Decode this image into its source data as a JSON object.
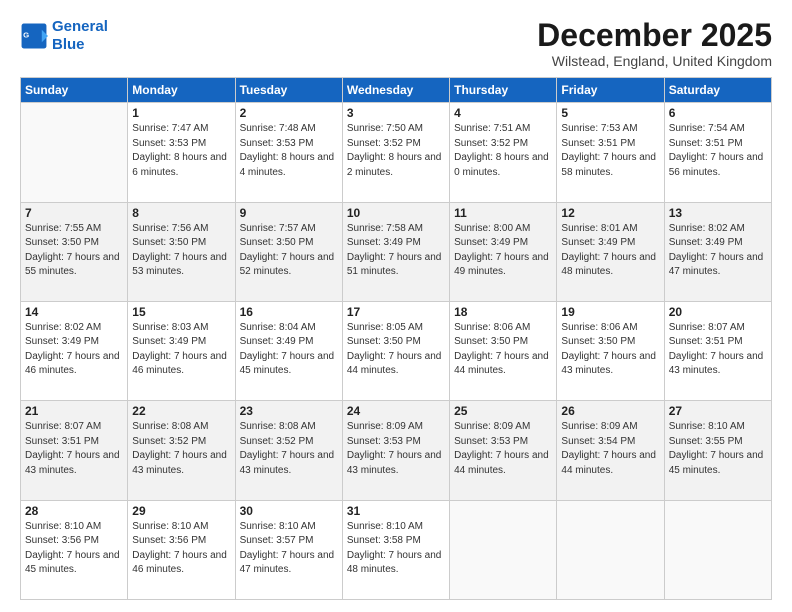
{
  "logo": {
    "line1": "General",
    "line2": "Blue"
  },
  "title": "December 2025",
  "location": "Wilstead, England, United Kingdom",
  "weekdays": [
    "Sunday",
    "Monday",
    "Tuesday",
    "Wednesday",
    "Thursday",
    "Friday",
    "Saturday"
  ],
  "weeks": [
    [
      {
        "day": "",
        "empty": true
      },
      {
        "day": "1",
        "sunrise": "Sunrise: 7:47 AM",
        "sunset": "Sunset: 3:53 PM",
        "daylight": "Daylight: 8 hours and 6 minutes."
      },
      {
        "day": "2",
        "sunrise": "Sunrise: 7:48 AM",
        "sunset": "Sunset: 3:53 PM",
        "daylight": "Daylight: 8 hours and 4 minutes."
      },
      {
        "day": "3",
        "sunrise": "Sunrise: 7:50 AM",
        "sunset": "Sunset: 3:52 PM",
        "daylight": "Daylight: 8 hours and 2 minutes."
      },
      {
        "day": "4",
        "sunrise": "Sunrise: 7:51 AM",
        "sunset": "Sunset: 3:52 PM",
        "daylight": "Daylight: 8 hours and 0 minutes."
      },
      {
        "day": "5",
        "sunrise": "Sunrise: 7:53 AM",
        "sunset": "Sunset: 3:51 PM",
        "daylight": "Daylight: 7 hours and 58 minutes."
      },
      {
        "day": "6",
        "sunrise": "Sunrise: 7:54 AM",
        "sunset": "Sunset: 3:51 PM",
        "daylight": "Daylight: 7 hours and 56 minutes."
      }
    ],
    [
      {
        "day": "7",
        "sunrise": "Sunrise: 7:55 AM",
        "sunset": "Sunset: 3:50 PM",
        "daylight": "Daylight: 7 hours and 55 minutes."
      },
      {
        "day": "8",
        "sunrise": "Sunrise: 7:56 AM",
        "sunset": "Sunset: 3:50 PM",
        "daylight": "Daylight: 7 hours and 53 minutes."
      },
      {
        "day": "9",
        "sunrise": "Sunrise: 7:57 AM",
        "sunset": "Sunset: 3:50 PM",
        "daylight": "Daylight: 7 hours and 52 minutes."
      },
      {
        "day": "10",
        "sunrise": "Sunrise: 7:58 AM",
        "sunset": "Sunset: 3:49 PM",
        "daylight": "Daylight: 7 hours and 51 minutes."
      },
      {
        "day": "11",
        "sunrise": "Sunrise: 8:00 AM",
        "sunset": "Sunset: 3:49 PM",
        "daylight": "Daylight: 7 hours and 49 minutes."
      },
      {
        "day": "12",
        "sunrise": "Sunrise: 8:01 AM",
        "sunset": "Sunset: 3:49 PM",
        "daylight": "Daylight: 7 hours and 48 minutes."
      },
      {
        "day": "13",
        "sunrise": "Sunrise: 8:02 AM",
        "sunset": "Sunset: 3:49 PM",
        "daylight": "Daylight: 7 hours and 47 minutes."
      }
    ],
    [
      {
        "day": "14",
        "sunrise": "Sunrise: 8:02 AM",
        "sunset": "Sunset: 3:49 PM",
        "daylight": "Daylight: 7 hours and 46 minutes."
      },
      {
        "day": "15",
        "sunrise": "Sunrise: 8:03 AM",
        "sunset": "Sunset: 3:49 PM",
        "daylight": "Daylight: 7 hours and 46 minutes."
      },
      {
        "day": "16",
        "sunrise": "Sunrise: 8:04 AM",
        "sunset": "Sunset: 3:49 PM",
        "daylight": "Daylight: 7 hours and 45 minutes."
      },
      {
        "day": "17",
        "sunrise": "Sunrise: 8:05 AM",
        "sunset": "Sunset: 3:50 PM",
        "daylight": "Daylight: 7 hours and 44 minutes."
      },
      {
        "day": "18",
        "sunrise": "Sunrise: 8:06 AM",
        "sunset": "Sunset: 3:50 PM",
        "daylight": "Daylight: 7 hours and 44 minutes."
      },
      {
        "day": "19",
        "sunrise": "Sunrise: 8:06 AM",
        "sunset": "Sunset: 3:50 PM",
        "daylight": "Daylight: 7 hours and 43 minutes."
      },
      {
        "day": "20",
        "sunrise": "Sunrise: 8:07 AM",
        "sunset": "Sunset: 3:51 PM",
        "daylight": "Daylight: 7 hours and 43 minutes."
      }
    ],
    [
      {
        "day": "21",
        "sunrise": "Sunrise: 8:07 AM",
        "sunset": "Sunset: 3:51 PM",
        "daylight": "Daylight: 7 hours and 43 minutes."
      },
      {
        "day": "22",
        "sunrise": "Sunrise: 8:08 AM",
        "sunset": "Sunset: 3:52 PM",
        "daylight": "Daylight: 7 hours and 43 minutes."
      },
      {
        "day": "23",
        "sunrise": "Sunrise: 8:08 AM",
        "sunset": "Sunset: 3:52 PM",
        "daylight": "Daylight: 7 hours and 43 minutes."
      },
      {
        "day": "24",
        "sunrise": "Sunrise: 8:09 AM",
        "sunset": "Sunset: 3:53 PM",
        "daylight": "Daylight: 7 hours and 43 minutes."
      },
      {
        "day": "25",
        "sunrise": "Sunrise: 8:09 AM",
        "sunset": "Sunset: 3:53 PM",
        "daylight": "Daylight: 7 hours and 44 minutes."
      },
      {
        "day": "26",
        "sunrise": "Sunrise: 8:09 AM",
        "sunset": "Sunset: 3:54 PM",
        "daylight": "Daylight: 7 hours and 44 minutes."
      },
      {
        "day": "27",
        "sunrise": "Sunrise: 8:10 AM",
        "sunset": "Sunset: 3:55 PM",
        "daylight": "Daylight: 7 hours and 45 minutes."
      }
    ],
    [
      {
        "day": "28",
        "sunrise": "Sunrise: 8:10 AM",
        "sunset": "Sunset: 3:56 PM",
        "daylight": "Daylight: 7 hours and 45 minutes."
      },
      {
        "day": "29",
        "sunrise": "Sunrise: 8:10 AM",
        "sunset": "Sunset: 3:56 PM",
        "daylight": "Daylight: 7 hours and 46 minutes."
      },
      {
        "day": "30",
        "sunrise": "Sunrise: 8:10 AM",
        "sunset": "Sunset: 3:57 PM",
        "daylight": "Daylight: 7 hours and 47 minutes."
      },
      {
        "day": "31",
        "sunrise": "Sunrise: 8:10 AM",
        "sunset": "Sunset: 3:58 PM",
        "daylight": "Daylight: 7 hours and 48 minutes."
      },
      {
        "day": "",
        "empty": true
      },
      {
        "day": "",
        "empty": true
      },
      {
        "day": "",
        "empty": true
      }
    ]
  ]
}
